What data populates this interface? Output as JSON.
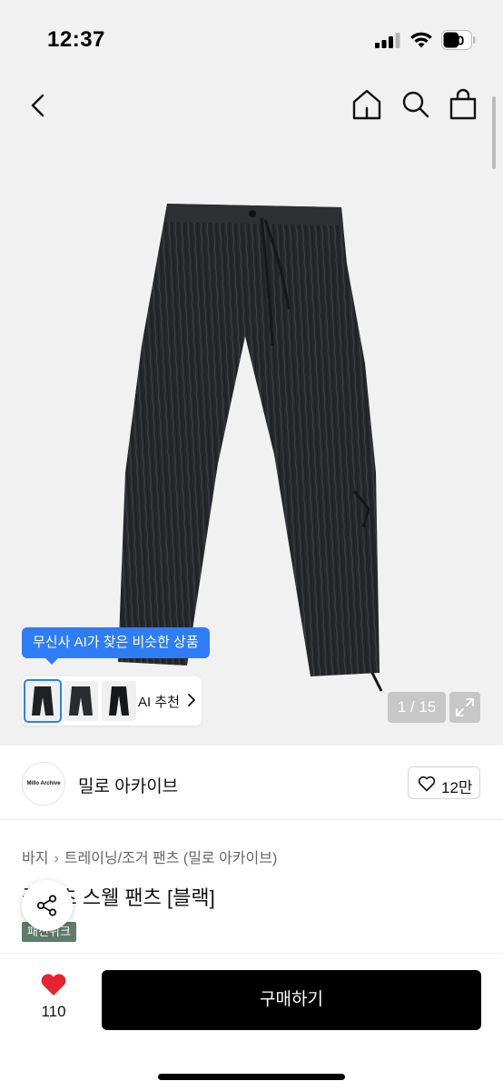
{
  "status_bar": {
    "time": "12:37",
    "battery": "50"
  },
  "nav": {
    "back": "back-icon",
    "home": "home-icon",
    "search": "search-icon",
    "bag": "shopping-bag-icon"
  },
  "gallery": {
    "counter": "1 / 15",
    "tooltip": "무신사 AI가 찾은 비슷한 상품",
    "ai_label": "AI 추천"
  },
  "brand": {
    "logo_text": "Millo Archive",
    "name": "밀로 아카이브",
    "likes": "12만"
  },
  "breadcrumb": [
    "바지",
    "트레이닝/조거 팬츠 (밀로 아카이브)"
  ],
  "product": {
    "title": "플리츠 스웰 팬츠 [블랙]",
    "tag": "패션위크"
  },
  "actions": {
    "wish_count": "110",
    "buy_label": "구매하기"
  },
  "colors": {
    "accent": "#2f7df6",
    "heart": "#e8222e",
    "buy": "#000000",
    "tag": "#5f7d68"
  }
}
